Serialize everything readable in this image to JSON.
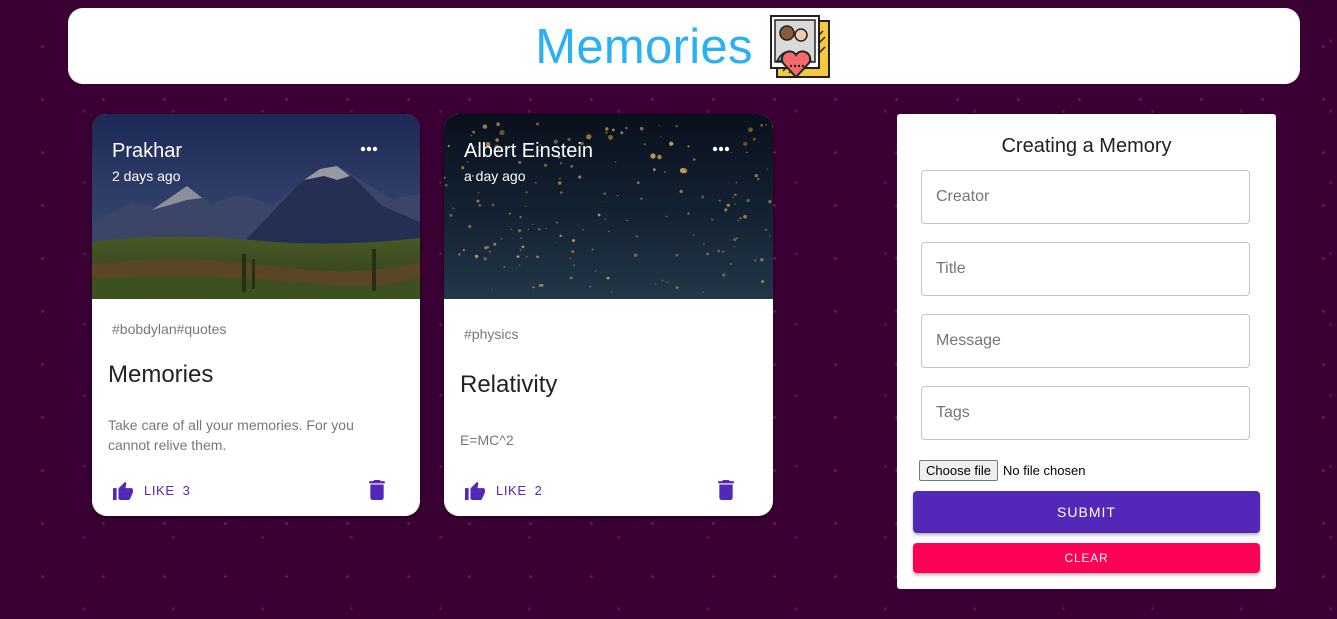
{
  "app": {
    "title": "Memories",
    "logo_icon": "memories-photo-heart-icon"
  },
  "posts": [
    {
      "creator": "Prakhar",
      "time": "2 days ago",
      "tags": "#bobdylan#quotes",
      "title": "Memories",
      "message": "Take care of all your memories. For you cannot relive them.",
      "like_label": "LIKE",
      "like_count": "3",
      "image": "mountain-landscape"
    },
    {
      "creator": "Albert Einstein",
      "time": "a day ago",
      "tags": "#physics",
      "title": "Relativity",
      "message": "E=MC^2",
      "like_label": "LIKE",
      "like_count": "2",
      "image": "sky-lanterns-night"
    }
  ],
  "form": {
    "heading": "Creating a Memory",
    "creator_placeholder": "Creator",
    "title_placeholder": "Title",
    "message_placeholder": "Message",
    "tags_placeholder": "Tags",
    "file_button": "Choose file",
    "file_status": "No file chosen",
    "submit_label": "SUBMIT",
    "clear_label": "CLEAR"
  },
  "colors": {
    "background": "#3a0033",
    "brand_title": "#29b0f5",
    "primary": "#5327b8",
    "secondary": "#ff0057"
  }
}
